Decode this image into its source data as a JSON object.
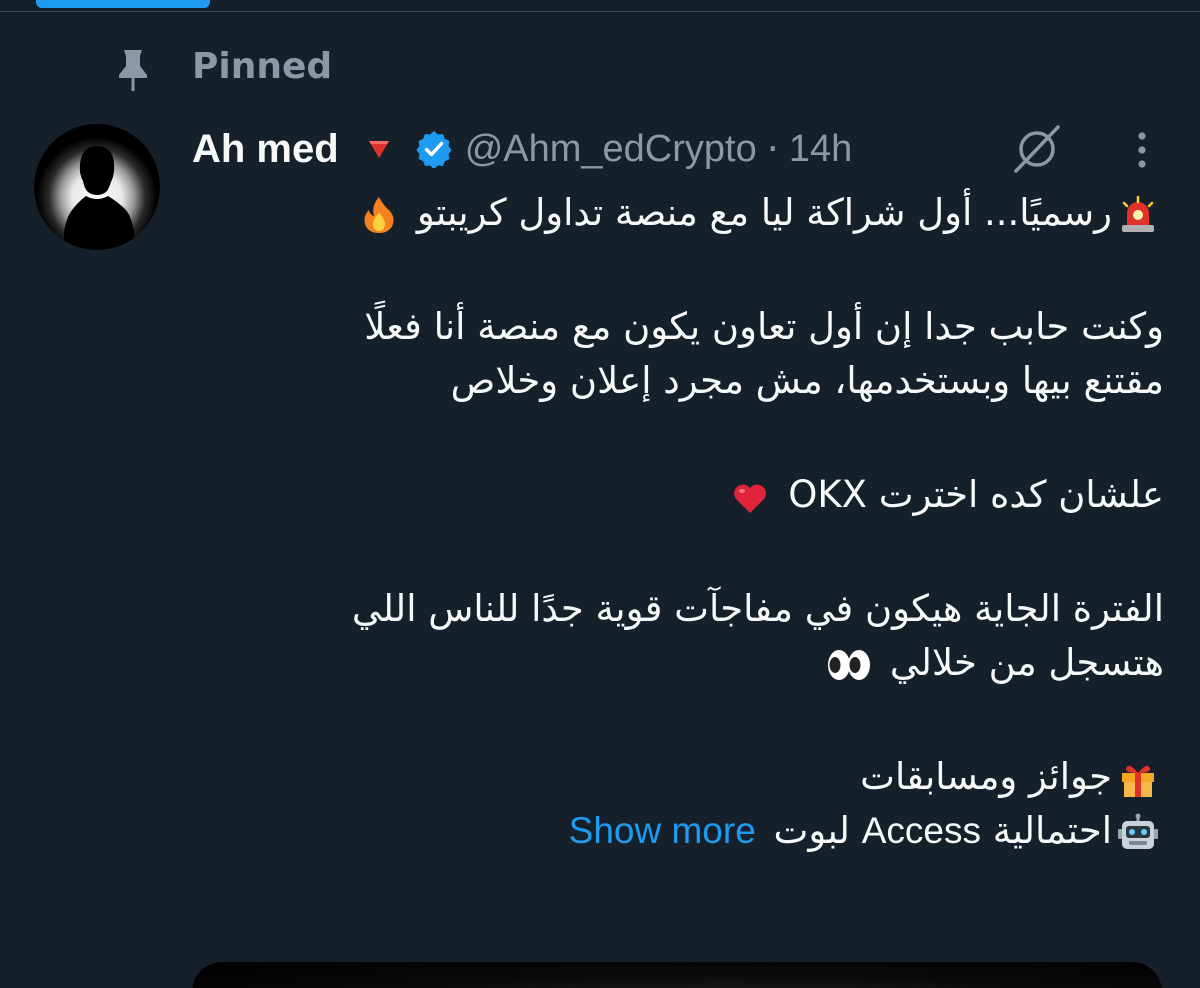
{
  "pinned": {
    "label": "Pinned",
    "icon": "pin-icon"
  },
  "author": {
    "display_name": "Ah med",
    "handle": "@Ahm_edCrypto",
    "separator": "·",
    "timestamp": "14h",
    "badges": [
      "red-triangle-icon",
      "verified-icon"
    ]
  },
  "tweet": {
    "lines": {
      "l1": "رسميًا... أول شراكة ليا مع منصة تداول كريبتو",
      "l2": "وكنت حابب جدا إن أول تعاون يكون مع منصة أنا فعلًا",
      "l3": "مقتنع بيها وبستخدمها، مش مجرد إعلان وخلاص",
      "l4": "علشان كده اخترت OKX",
      "l5": "الفترة الجاية هيكون في مفاجآت قوية جدًا للناس اللي",
      "l6": "هتسجل من خلالي",
      "l7": "جوائز ومسابقات",
      "l8_a": "احتمالية",
      "l8_b": "Access",
      "l8_c": "لبوت"
    },
    "show_more": "Show more",
    "emojis": [
      "siren-emoji",
      "fire-emoji",
      "red-heart-emoji",
      "eyes-emoji",
      "gift-emoji",
      "robot-emoji"
    ]
  },
  "colors": {
    "background": "#15202b",
    "accent": "#1d9bf0",
    "secondary_text": "#8b98a5",
    "primary_text": "#f7f9f9"
  }
}
